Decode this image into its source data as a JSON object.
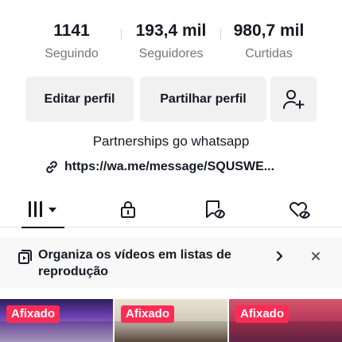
{
  "stats": [
    {
      "value": "1141",
      "label": "Seguindo"
    },
    {
      "value": "193,4 mil",
      "label": "Seguidores"
    },
    {
      "value": "980,7 mil",
      "label": "Curtidas"
    }
  ],
  "buttons": {
    "edit_label": "Editar perfil",
    "share_label": "Partilhar perfil",
    "add_friend_icon": "add-user-icon"
  },
  "bio": "Partnerships go whatsapp",
  "link": {
    "text": "https://wa.me/message/SQUSWE...",
    "icon": "link-icon"
  },
  "tabs": [
    {
      "icon": "videos-grid-icon",
      "active": true
    },
    {
      "icon": "lock-icon",
      "active": false
    },
    {
      "icon": "reposts-icon",
      "active": false
    },
    {
      "icon": "liked-heart-icon",
      "active": false
    }
  ],
  "banner": {
    "text": "Organiza os vídeos em listas de reprodução",
    "icon": "playlist-icon"
  },
  "videos": [
    {
      "badge": "Afixado"
    },
    {
      "badge": "Afixado"
    },
    {
      "badge": "Afixado"
    }
  ],
  "colors": {
    "accent": "#fe2c55",
    "text": "#161823",
    "muted": "#75767c",
    "button_bg": "#f1f1f2"
  }
}
